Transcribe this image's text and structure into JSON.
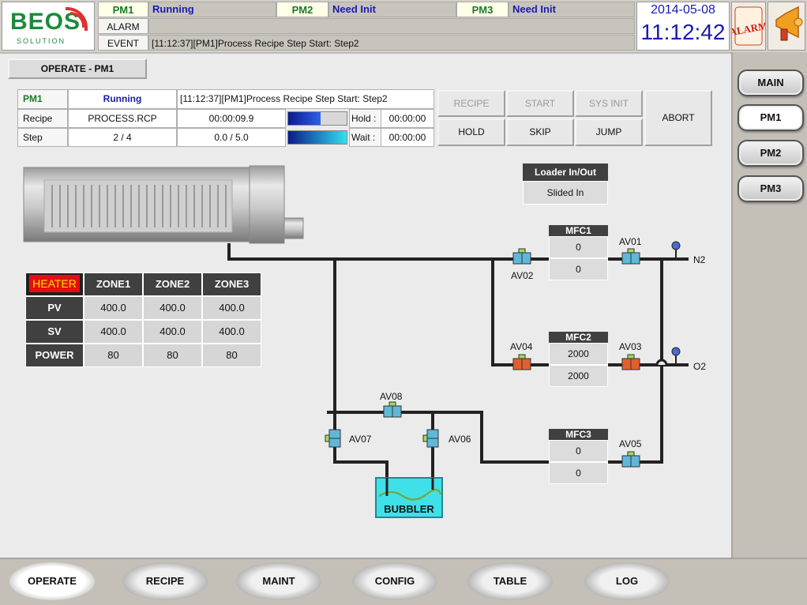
{
  "header": {
    "pm_status": [
      {
        "label": "PM1",
        "status": "Running"
      },
      {
        "label": "PM2",
        "status": "Need Init"
      },
      {
        "label": "PM3",
        "status": "Need Init"
      }
    ],
    "alarm_label": "ALARM",
    "alarm_value": "",
    "event_label": "EVENT",
    "event_value": "[11:12:37][PM1]Process Recipe Step Start: Step2",
    "date": "2014-05-08",
    "time": "11:12:42",
    "alarm_icon_text": "ALARM",
    "logo_text": "BEOS",
    "logo_sub": "SOLUTION"
  },
  "page_title": "OPERATE - PM1",
  "status_panel": {
    "pm": "PM1",
    "state": "Running",
    "message": "[11:12:37][PM1]Process Recipe Step Start: Step2",
    "recipe_label": "Recipe",
    "recipe_name": "PROCESS.RCP",
    "recipe_time": "00:00:09.9",
    "recipe_progress": 0.55,
    "hold_label": "Hold :",
    "hold_time": "00:00:00",
    "step_label": "Step",
    "step_value": "2 / 4",
    "step_time": "0.0 / 5.0",
    "step_progress": 1.0,
    "wait_label": "Wait :",
    "wait_time": "00:00:00"
  },
  "control_buttons": {
    "recipe": "RECIPE",
    "start": "START",
    "sys_init": "SYS INIT",
    "hold": "HOLD",
    "skip": "SKIP",
    "jump": "JUMP",
    "abort": "ABORT"
  },
  "heater": {
    "title": "HEATER",
    "zones": [
      "ZONE1",
      "ZONE2",
      "ZONE3"
    ],
    "rows": [
      {
        "label": "PV",
        "values": [
          "400.0",
          "400.0",
          "400.0"
        ]
      },
      {
        "label": "SV",
        "values": [
          "400.0",
          "400.0",
          "400.0"
        ]
      },
      {
        "label": "POWER",
        "values": [
          "80",
          "80",
          "80"
        ]
      }
    ]
  },
  "loader": {
    "title": "Loader In/Out",
    "value": "Slided In"
  },
  "mfcs": [
    {
      "name": "MFC1",
      "setpoint": "0",
      "actual": "0"
    },
    {
      "name": "MFC2",
      "setpoint": "2000",
      "actual": "2000"
    },
    {
      "name": "MFC3",
      "setpoint": "0",
      "actual": "0"
    }
  ],
  "valves": {
    "av01": "AV01",
    "av02": "AV02",
    "av03": "AV03",
    "av04": "AV04",
    "av05": "AV05",
    "av06": "AV06",
    "av07": "AV07",
    "av08": "AV08"
  },
  "gases": {
    "n2": "N2",
    "o2": "O2"
  },
  "bubbler": "BUBBLER",
  "right_nav": [
    "MAIN",
    "PM1",
    "PM2",
    "PM3"
  ],
  "bottom_nav": [
    "OPERATE",
    "RECIPE",
    "MAINT",
    "CONFIG",
    "TABLE",
    "LOG"
  ],
  "colors": {
    "open_valve": "#4aa8c8",
    "active_valve": "#e06030",
    "bubbler": "#40e0e0",
    "status_blue": "#1a1ab0"
  }
}
